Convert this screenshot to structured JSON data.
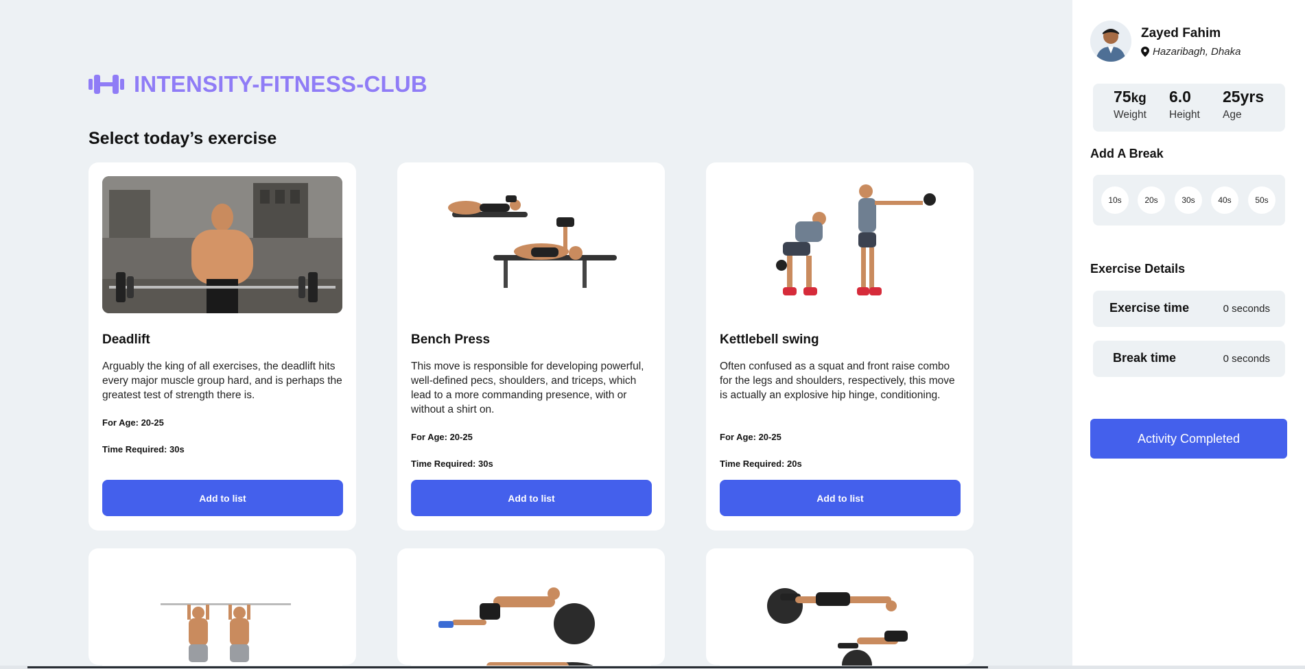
{
  "brand": {
    "title": "INTENSITY-FITNESS-CLUB",
    "icon": "dumbbell-icon",
    "color": "#8f7cf6"
  },
  "section_title": "Select today’s exercise",
  "cards": [
    {
      "name": "Deadlift",
      "description": "Arguably the king of all exercises, the deadlift hits every major muscle group hard, and is perhaps the greatest test of strength there is.",
      "age": "For Age: 20-25",
      "time": "Time Required: 30s",
      "button": "Add to list"
    },
    {
      "name": "Bench Press",
      "description": "This move is responsible for developing powerful, well-defined pecs, shoulders, and triceps, which lead to a more commanding presence, with or without a shirt on.",
      "age": "For Age: 20-25",
      "time": "Time Required: 30s",
      "button": "Add to list"
    },
    {
      "name": "Kettlebell swing",
      "description": "Often confused as a squat and front raise combo for the legs and shoulders, respectively, this move is actually an explosive hip hinge, conditioning.",
      "age": "For Age: 20-25",
      "time": "Time Required: 20s",
      "button": "Add to list"
    }
  ],
  "profile": {
    "name": "Zayed Fahim",
    "location": "Hazaribagh, Dhaka",
    "stats": {
      "weight_value": "75",
      "weight_unit": "kg",
      "weight_label": "Weight",
      "height_value": "6.0",
      "height_label": "Height",
      "age_value": "25",
      "age_unit": "yrs",
      "age_label": "Age"
    }
  },
  "break": {
    "title": "Add A Break",
    "options": [
      "10s",
      "20s",
      "30s",
      "40s",
      "50s"
    ]
  },
  "details": {
    "title": "Exercise Details",
    "exercise_label": "Exercise time",
    "exercise_value": "0 seconds",
    "break_label": "Break time",
    "break_value": "0 seconds"
  },
  "complete_button": "Activity Completed",
  "colors": {
    "accent": "#4460ec",
    "background": "#edf1f4"
  }
}
